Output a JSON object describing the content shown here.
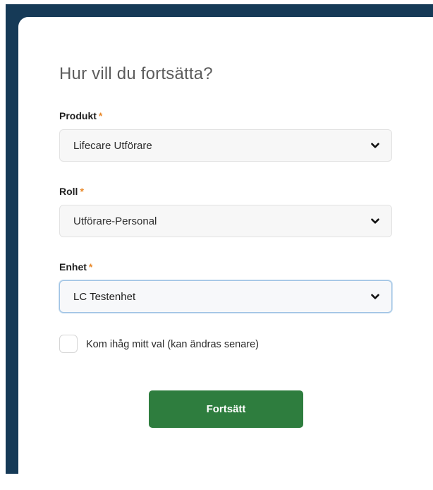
{
  "form": {
    "heading": "Hur vill du fortsätta?",
    "required_marker": "*",
    "fields": [
      {
        "label": "Produkt",
        "selected_value": "Lifecare Utförare",
        "icon": "chevron-down-icon"
      },
      {
        "label": "Roll",
        "selected_value": "Utförare-Personal",
        "icon": "chevron-down-icon"
      },
      {
        "label": "Enhet",
        "selected_value": "LC Testenhet",
        "icon": "chevron-down-icon",
        "focused": true
      }
    ],
    "remember_choice": {
      "label": "Kom ihåg mitt val (kan ändras senare)",
      "checked": false
    },
    "submit_label": "Fortsätt"
  },
  "colors": {
    "backdrop": "#163a57",
    "card": "#ffffff",
    "required_marker": "#e98a2c",
    "button": "#2e7d3e",
    "focus_border": "#9fc3e4"
  }
}
